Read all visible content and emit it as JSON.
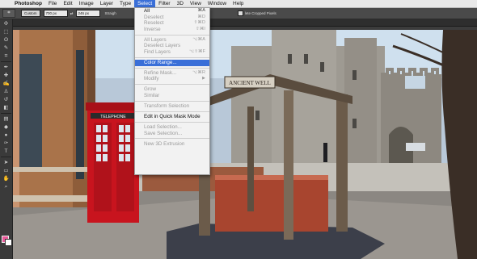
{
  "app_menu": {
    "apple_icon": "",
    "items": [
      "Photoshop",
      "File",
      "Edit",
      "Image",
      "Layer",
      "Type",
      "Select",
      "Filter",
      "3D",
      "View",
      "Window",
      "Help"
    ]
  },
  "options_bar": {
    "tool_icon": "crop-icon",
    "ratio_select": "Custom",
    "width_value": "700 px",
    "swap_icon": "⇄",
    "height_value": "246 px",
    "straighten_label": "Straigh",
    "delete_label": "lete Cropped Pixels"
  },
  "select_menu": {
    "items": [
      {
        "label": "All",
        "shortcut": "⌘A",
        "enabled": true
      },
      {
        "label": "Deselect",
        "shortcut": "⌘D",
        "enabled": false
      },
      {
        "label": "Reselect",
        "shortcut": "⇧⌘D",
        "enabled": false
      },
      {
        "label": "Inverse",
        "shortcut": "⇧⌘I",
        "enabled": false
      },
      {
        "sep": true
      },
      {
        "label": "All Layers",
        "shortcut": "⌥⌘A",
        "enabled": false
      },
      {
        "label": "Deselect Layers",
        "shortcut": "",
        "enabled": false
      },
      {
        "label": "Find Layers",
        "shortcut": "⌥⇧⌘F",
        "enabled": false
      },
      {
        "sep": true
      },
      {
        "label": "Color Range...",
        "shortcut": "",
        "enabled": true,
        "highlighted": true
      },
      {
        "sep": true
      },
      {
        "label": "Refine Mask...",
        "shortcut": "⌥⌘R",
        "enabled": false
      },
      {
        "label": "Modify",
        "shortcut": "",
        "enabled": false,
        "submenu": true
      },
      {
        "sep": true
      },
      {
        "label": "Grow",
        "shortcut": "",
        "enabled": false
      },
      {
        "label": "Similar",
        "shortcut": "",
        "enabled": false
      },
      {
        "sep": true
      },
      {
        "label": "Transform Selection",
        "shortcut": "",
        "enabled": false
      },
      {
        "sep": true
      },
      {
        "label": "Edit in Quick Mask Mode",
        "shortcut": "",
        "enabled": true
      },
      {
        "sep": true
      },
      {
        "label": "Load Selection...",
        "shortcut": "",
        "enabled": false
      },
      {
        "label": "Save Selection...",
        "shortcut": "",
        "enabled": false
      },
      {
        "sep": true
      },
      {
        "label": "New 3D Extrusion",
        "shortcut": "",
        "enabled": false
      }
    ]
  },
  "toolbar": {
    "tools": [
      {
        "name": "move-tool-icon",
        "glyph": "✣"
      },
      {
        "name": "marquee-tool-icon",
        "glyph": "⬚"
      },
      {
        "name": "lasso-tool-icon",
        "glyph": "ʘ"
      },
      {
        "name": "quick-select-tool-icon",
        "glyph": "✎"
      },
      {
        "name": "crop-tool-icon",
        "glyph": "⌗"
      },
      {
        "name": "eyedropper-tool-icon",
        "glyph": "✒"
      },
      {
        "name": "healing-tool-icon",
        "glyph": "✚"
      },
      {
        "name": "brush-tool-icon",
        "glyph": "✍"
      },
      {
        "name": "clone-stamp-tool-icon",
        "glyph": "♙"
      },
      {
        "name": "history-brush-tool-icon",
        "glyph": "↺"
      },
      {
        "name": "eraser-tool-icon",
        "glyph": "◧"
      },
      {
        "name": "gradient-tool-icon",
        "glyph": "▤"
      },
      {
        "name": "blur-tool-icon",
        "glyph": "◆"
      },
      {
        "name": "dodge-tool-icon",
        "glyph": "●"
      },
      {
        "name": "pen-tool-icon",
        "glyph": "✑"
      },
      {
        "name": "type-tool-icon",
        "glyph": "T"
      },
      {
        "name": "path-select-tool-icon",
        "glyph": "➤"
      },
      {
        "name": "shape-tool-icon",
        "glyph": "▭"
      },
      {
        "name": "hand-tool-icon",
        "glyph": "✋"
      },
      {
        "name": "zoom-tool-icon",
        "glyph": "⌕"
      }
    ],
    "foreground_color": "#e85a9a",
    "background_color": "#ffffff"
  },
  "photo": {
    "sign_text": "ANCIENT WELL",
    "phone_box_text": "TELEPHONE"
  },
  "colors": {
    "menu_highlight": "#3a6fd8",
    "phone_box_red": "#c8141e"
  }
}
